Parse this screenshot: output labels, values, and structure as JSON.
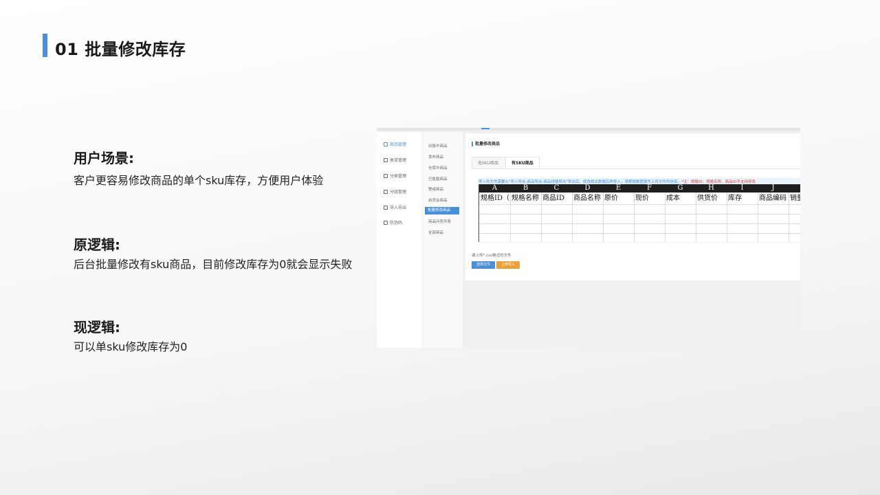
{
  "page": {
    "title": "01 批量修改库存",
    "accent_color": "#4a8fd8"
  },
  "sections": [
    {
      "heading": "用户场景:",
      "body": "客户更容易修改商品的单个sku库存，方便用户体验"
    },
    {
      "heading": "原逻辑:",
      "body": "后台批量修改有sku商品，目前修改库存为0就会显示失败"
    },
    {
      "heading": "现逻辑:",
      "body": "可以单sku修改库存为0"
    }
  ],
  "screenshot": {
    "sidebar": [
      {
        "label": "商品管理",
        "icon": "box-icon",
        "active": true
      },
      {
        "label": "类目管理",
        "icon": "list-icon",
        "active": false
      },
      {
        "label": "分类管理",
        "icon": "grid-icon",
        "active": false
      },
      {
        "label": "分组管理",
        "icon": "group-icon",
        "active": false
      },
      {
        "label": "导入导出",
        "icon": "import-icon",
        "active": false
      },
      {
        "label": "防伪码",
        "icon": "qrcode-icon",
        "active": false
      }
    ],
    "subnav": [
      {
        "label": "出售中商品",
        "active": false
      },
      {
        "label": "发布商品",
        "active": false
      },
      {
        "label": "仓库中商品",
        "active": false
      },
      {
        "label": "已售罄商品",
        "active": false
      },
      {
        "label": "警戒商品",
        "active": false
      },
      {
        "label": "启货会商品",
        "active": false
      },
      {
        "label": "批量修改商品",
        "active": true
      },
      {
        "label": "商品问答列表",
        "active": false
      },
      {
        "label": "全部商品",
        "active": false
      }
    ],
    "main_title": "批量修改商品",
    "tabs": [
      {
        "label": "无SKU商品",
        "active": false
      },
      {
        "label": "有SKU商品",
        "active": true
      }
    ],
    "notice": "导入的文件需要从\"导入导出-商品导出-商品规格导出\"导出后，修改相关数据后再导入，请根据截图填写上传文件的信息。",
    "notice_warning": "*注：规格ID、规格名称、商品ID不支持修改",
    "sheet_columns": [
      "A",
      "B",
      "C",
      "D",
      "E",
      "F",
      "G",
      "H",
      "I",
      "J"
    ],
    "sheet_headers": [
      "规格ID（",
      "规格名称",
      "商品ID",
      "商品名称",
      "原价",
      "现价",
      "成本",
      "供货价",
      "库存",
      "商品编码",
      "销量"
    ],
    "upload_hint": "请上传*.csv格式的文件",
    "buttons": {
      "choose": "选择文件",
      "upload": "上传导入"
    }
  }
}
